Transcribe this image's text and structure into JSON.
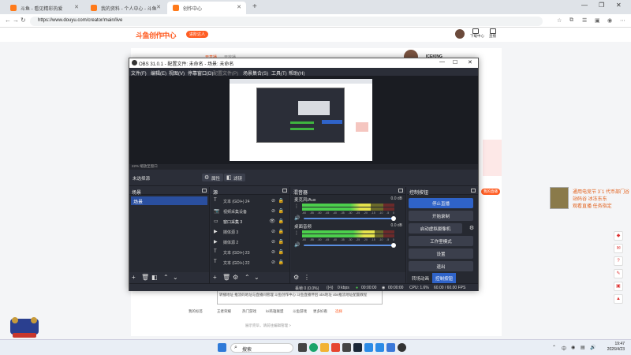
{
  "browser": {
    "tabs": [
      {
        "label": "斗鱼 - 看见精彩热爱"
      },
      {
        "label": "我的资料 - 个人中心 - 斗鱼"
      },
      {
        "label": "创作中心"
      }
    ],
    "new_tab": "+",
    "url": "https://www.douyu.com/creator/main/live"
  },
  "site": {
    "logo": "斗鱼创作中心",
    "badge": "进阶达人",
    "header_items": [
      "下载中心",
      "直播"
    ],
    "card_tabs": [
      "开直播",
      "开放播"
    ],
    "username": "ICEKING",
    "right_tag": "我的直播",
    "promo_lines": [
      "通用电竞节 3`1 代币部门谷",
      "站码谷 冰冻东东",
      "观看直播 任务指定"
    ],
    "bottom_box_text": "转播地址 推流码地址与直播间管理 斗鱼创作中心 斗鱼直播伴侣 obs地址 obs推流地址配置教程",
    "bottom_links": [
      "我的标签",
      "王者荣耀",
      "热门游戏",
      "lol英雄联盟",
      "斗鱼游戏",
      "更多好看",
      "选择"
    ],
    "bottom_note": "展示完毕，请前往编辑管理 >"
  },
  "obs": {
    "title": "OBS 31.0.1 - 配置文件: 未命名 - 场景: 未命名",
    "menu": [
      "文件(F)",
      "编辑(E)",
      "视图(V)",
      "停靠窗口(D)",
      "配置文件(P)",
      "场景集合(S)",
      "工具(T)",
      "帮助(H)"
    ],
    "zoom_text": "22% 缩放至窗口",
    "no_source": "未选择源",
    "props_btn": "属性",
    "filters_btn": "滤镜",
    "docks": {
      "scenes": {
        "title": "场景",
        "items": [
          "场景"
        ]
      },
      "sources": {
        "title": "源",
        "items": [
          {
            "label": "文本 (GDI+) 24",
            "icon": "text-icon"
          },
          {
            "label": "视频采集设备",
            "icon": "camera-icon"
          },
          {
            "label": "窗口采集 3",
            "icon": "window-icon"
          },
          {
            "label": "媒体源 3",
            "icon": "play-icon"
          },
          {
            "label": "媒体源 2",
            "icon": "play-icon"
          },
          {
            "label": "文本 (GDI+) 23",
            "icon": "text-icon"
          },
          {
            "label": "文本 (GDI+) 22",
            "icon": "text-icon"
          }
        ]
      },
      "mixer": {
        "title": "混音器",
        "tracks": [
          {
            "name": "麦克风/Aux",
            "db": "0.0 dB",
            "level": 0.74
          },
          {
            "name": "桌面音频",
            "db": "0.0 dB",
            "level": 0.79
          }
        ],
        "scale": [
          "-60",
          "-55",
          "-50",
          "-45",
          "-40",
          "-35",
          "-30",
          "-25",
          "-20",
          "-15",
          "-10",
          "-5",
          "0"
        ]
      },
      "controls": {
        "title": "控制按钮",
        "buttons": [
          "停止直播",
          "开始录制",
          "启动虚拟摄像机",
          "工作室模式",
          "设置",
          "退出"
        ],
        "tabs": [
          "转场动画",
          "控制按钮"
        ]
      }
    },
    "status": {
      "dropped": "丢帧 0 (0.0%)",
      "bitrate": "0 kbps",
      "stream_time": "00:00:00",
      "rec_time": "00:00:00",
      "cpu": "CPU: 1.6%",
      "fps": "60.00 / 60.00 FPS"
    }
  },
  "taskbar": {
    "search_placeholder": "搜索",
    "time": "19:47",
    "date": "2026/4/23",
    "lang": "中"
  },
  "colors": {
    "brand": "#ff5d23",
    "obs_bg": "#2b2e38",
    "obs_accent": "#2f63c8"
  }
}
